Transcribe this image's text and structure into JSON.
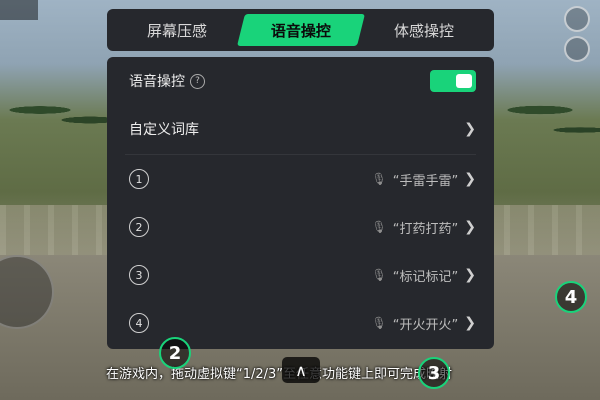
{
  "tabs": [
    {
      "label": "屏幕压感"
    },
    {
      "label": "语音操控",
      "active": true
    },
    {
      "label": "体感操控"
    }
  ],
  "panel": {
    "voice_control": {
      "label": "语音操控",
      "help_icon": "question-circle-icon",
      "enabled": true
    },
    "custom_lexicon": {
      "label": "自定义词库",
      "icon": "chevron-right-icon"
    },
    "commands": [
      {
        "index": "1",
        "phrase": "“手雷手雷”"
      },
      {
        "index": "2",
        "phrase": "“打药打药”"
      },
      {
        "index": "3",
        "phrase": "“标记标记”"
      },
      {
        "index": "4",
        "phrase": "“开火开火”"
      }
    ]
  },
  "caption": "在游戏内，拖动虚拟键“1/2/3”至任意功能键上即可完成映射",
  "step_markers": [
    "2",
    "3",
    "4"
  ],
  "colors": {
    "accent": "#19d37a",
    "panel_bg": "#26282d"
  }
}
